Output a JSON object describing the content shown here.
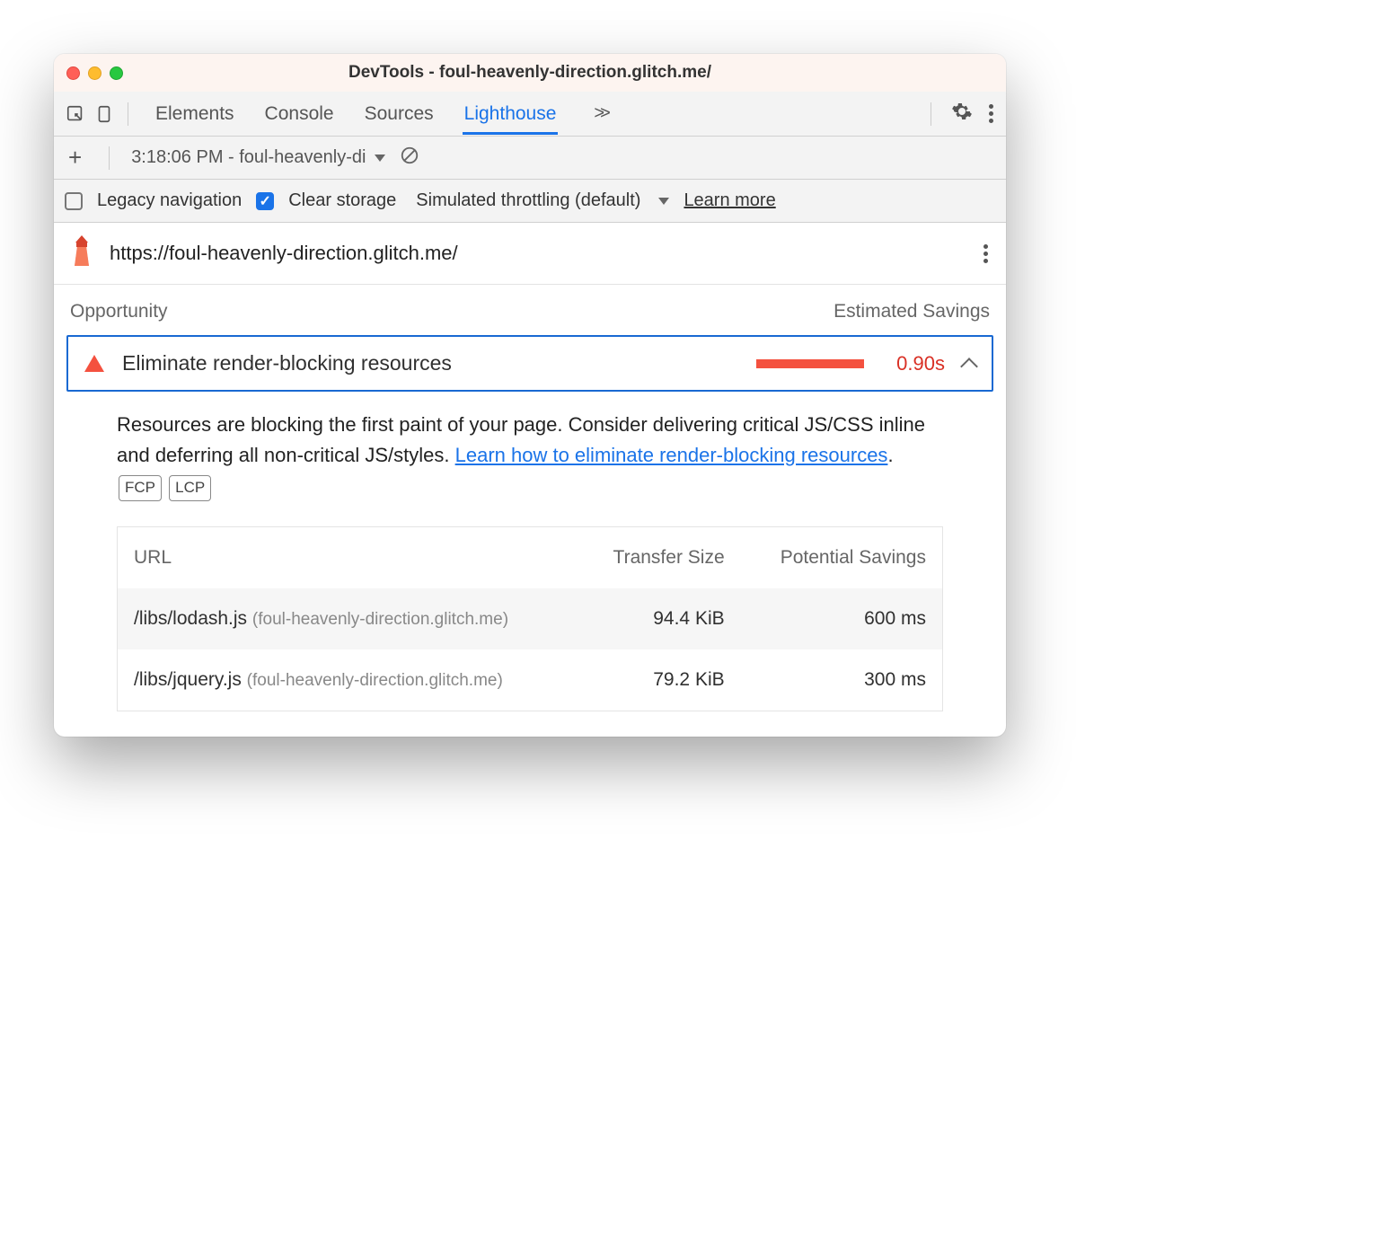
{
  "window": {
    "title": "DevTools - foul-heavenly-direction.glitch.me/"
  },
  "tabs": {
    "items": [
      "Elements",
      "Console",
      "Sources",
      "Lighthouse"
    ],
    "active": "Lighthouse"
  },
  "subbar": {
    "report_selector": "3:18:06 PM - foul-heavenly-di"
  },
  "options": {
    "legacy_label": "Legacy navigation",
    "legacy_checked": false,
    "clear_label": "Clear storage",
    "clear_checked": true,
    "throttling_label": "Simulated throttling (default)",
    "learn_more": "Learn more"
  },
  "report": {
    "url": "https://foul-heavenly-direction.glitch.me/",
    "section": {
      "left": "Opportunity",
      "right": "Estimated Savings"
    },
    "audit": {
      "title": "Eliminate render-blocking resources",
      "savings": "0.90s",
      "description_pre": "Resources are blocking the first paint of your page. Consider delivering critical JS/CSS inline and deferring all non-critical JS/styles. ",
      "description_link": "Learn how to eliminate render-blocking resources",
      "description_post": ".",
      "badges": [
        "FCP",
        "LCP"
      ]
    },
    "table": {
      "headers": {
        "url": "URL",
        "size": "Transfer Size",
        "savings": "Potential Savings"
      },
      "rows": [
        {
          "path": "/libs/lodash.js",
          "host": "(foul-heavenly-direction.glitch.me)",
          "size": "94.4 KiB",
          "savings": "600 ms"
        },
        {
          "path": "/libs/jquery.js",
          "host": "(foul-heavenly-direction.glitch.me)",
          "size": "79.2 KiB",
          "savings": "300 ms"
        }
      ]
    }
  }
}
